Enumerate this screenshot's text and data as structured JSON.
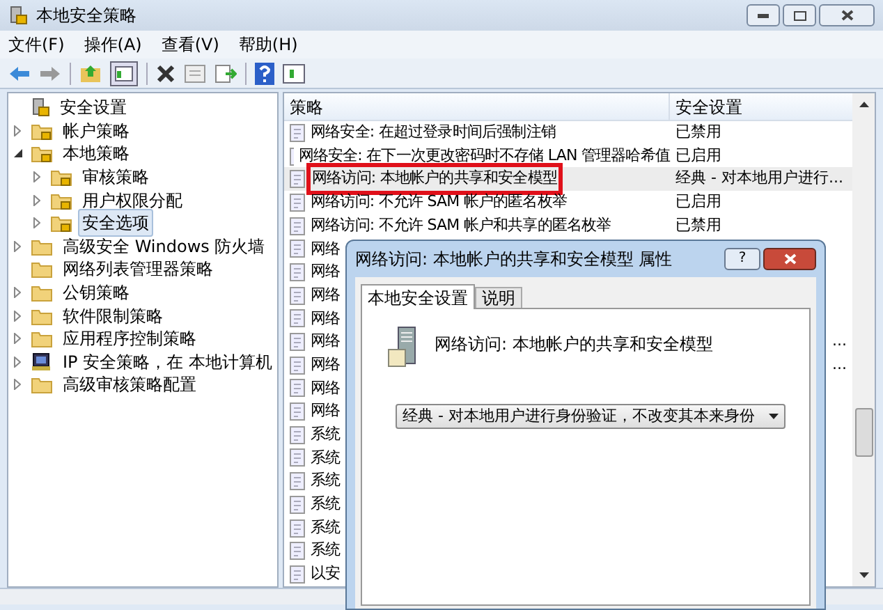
{
  "window": {
    "title": "本地安全策略"
  },
  "menu": [
    "文件(F)",
    "操作(A)",
    "查看(V)",
    "帮助(H)"
  ],
  "tree": [
    {
      "label": "安全设置",
      "kind": "root",
      "expandable": false,
      "selected": false,
      "children": [
        {
          "label": "帐户策略",
          "kind": "lock",
          "expandable": true,
          "expanded": false,
          "selected": false
        },
        {
          "label": "本地策略",
          "kind": "lock",
          "expandable": true,
          "expanded": true,
          "selected": false,
          "children": [
            {
              "label": "审核策略",
              "kind": "lock",
              "expandable": true,
              "expanded": false,
              "selected": false
            },
            {
              "label": "用户权限分配",
              "kind": "lock",
              "expandable": true,
              "expanded": false,
              "selected": false
            },
            {
              "label": "安全选项",
              "kind": "lock",
              "expandable": true,
              "expanded": false,
              "selected": true
            }
          ]
        },
        {
          "label": "高级安全 Windows 防火墙",
          "kind": "folder",
          "expandable": true,
          "expanded": false,
          "selected": false
        },
        {
          "label": "网络列表管理器策略",
          "kind": "folder",
          "expandable": false,
          "selected": false
        },
        {
          "label": "公钥策略",
          "kind": "folder",
          "expandable": true,
          "expanded": false,
          "selected": false
        },
        {
          "label": "软件限制策略",
          "kind": "folder",
          "expandable": true,
          "expanded": false,
          "selected": false
        },
        {
          "label": "应用程序控制策略",
          "kind": "folder",
          "expandable": true,
          "expanded": false,
          "selected": false
        },
        {
          "label": "IP 安全策略，在 本地计算机",
          "kind": "computer",
          "expandable": true,
          "expanded": false,
          "selected": false
        },
        {
          "label": "高级审核策略配置",
          "kind": "folder",
          "expandable": true,
          "expanded": false,
          "selected": false
        }
      ]
    }
  ],
  "table": {
    "columns": [
      "策略",
      "安全设置"
    ],
    "rows": [
      {
        "policy": "网络安全: 在超过登录时间后强制注销",
        "setting": "已禁用",
        "setting_tail_only": false,
        "selected": false,
        "highlighted": false
      },
      {
        "policy": "网络安全: 在下一次更改密码时不存储 LAN 管理器哈希值",
        "setting": "已启用",
        "setting_tail_only": false,
        "selected": false,
        "highlighted": false
      },
      {
        "policy": "网络访问: 本地帐户的共享和安全模型",
        "setting": "经典 - 对本地用户进行...",
        "setting_tail_only": false,
        "selected": true,
        "highlighted": true
      },
      {
        "policy": "网络访问: 不允许 SAM 帐户的匿名枚举",
        "setting": "已启用",
        "setting_tail_only": false,
        "selected": false,
        "highlighted": false
      },
      {
        "policy": "网络访问: 不允许 SAM 帐户和共享的匿名枚举",
        "setting": "已禁用",
        "setting_tail_only": false,
        "selected": false,
        "highlighted": false
      },
      {
        "policy": "网络",
        "selected": false,
        "highlighted": false
      },
      {
        "policy": "网络",
        "selected": false,
        "highlighted": false
      },
      {
        "policy": "网络",
        "selected": false,
        "highlighted": false
      },
      {
        "policy": "网络",
        "selected": false,
        "highlighted": false
      },
      {
        "policy": "网络",
        "setting": "...",
        "setting_tail_only": true,
        "selected": false,
        "highlighted": false
      },
      {
        "policy": "网络",
        "setting": "...",
        "setting_tail_only": true,
        "selected": false,
        "highlighted": false
      },
      {
        "policy": "网络",
        "selected": false,
        "highlighted": false
      },
      {
        "policy": "网络",
        "selected": false,
        "highlighted": false
      },
      {
        "policy": "系统",
        "selected": false,
        "highlighted": false
      },
      {
        "policy": "系统",
        "selected": false,
        "highlighted": false
      },
      {
        "policy": "系统",
        "selected": false,
        "highlighted": false
      },
      {
        "policy": "系统",
        "selected": false,
        "highlighted": false
      },
      {
        "policy": "系统",
        "selected": false,
        "highlighted": false
      },
      {
        "policy": "系统",
        "selected": false,
        "highlighted": false
      },
      {
        "policy": "以安",
        "selected": false,
        "highlighted": false
      }
    ]
  },
  "dialog": {
    "title": "网络访问: 本地帐户的共享和安全模型 属性",
    "help": "?",
    "tabs": [
      {
        "label": "本地安全设置",
        "selected": true
      },
      {
        "label": "说明",
        "selected": false
      }
    ],
    "policy_name": "网络访问:  本地帐户的共享和安全模型",
    "dropdown": {
      "value": "经典 - 对本地用户进行身份验证，不改变其本来身份"
    }
  }
}
